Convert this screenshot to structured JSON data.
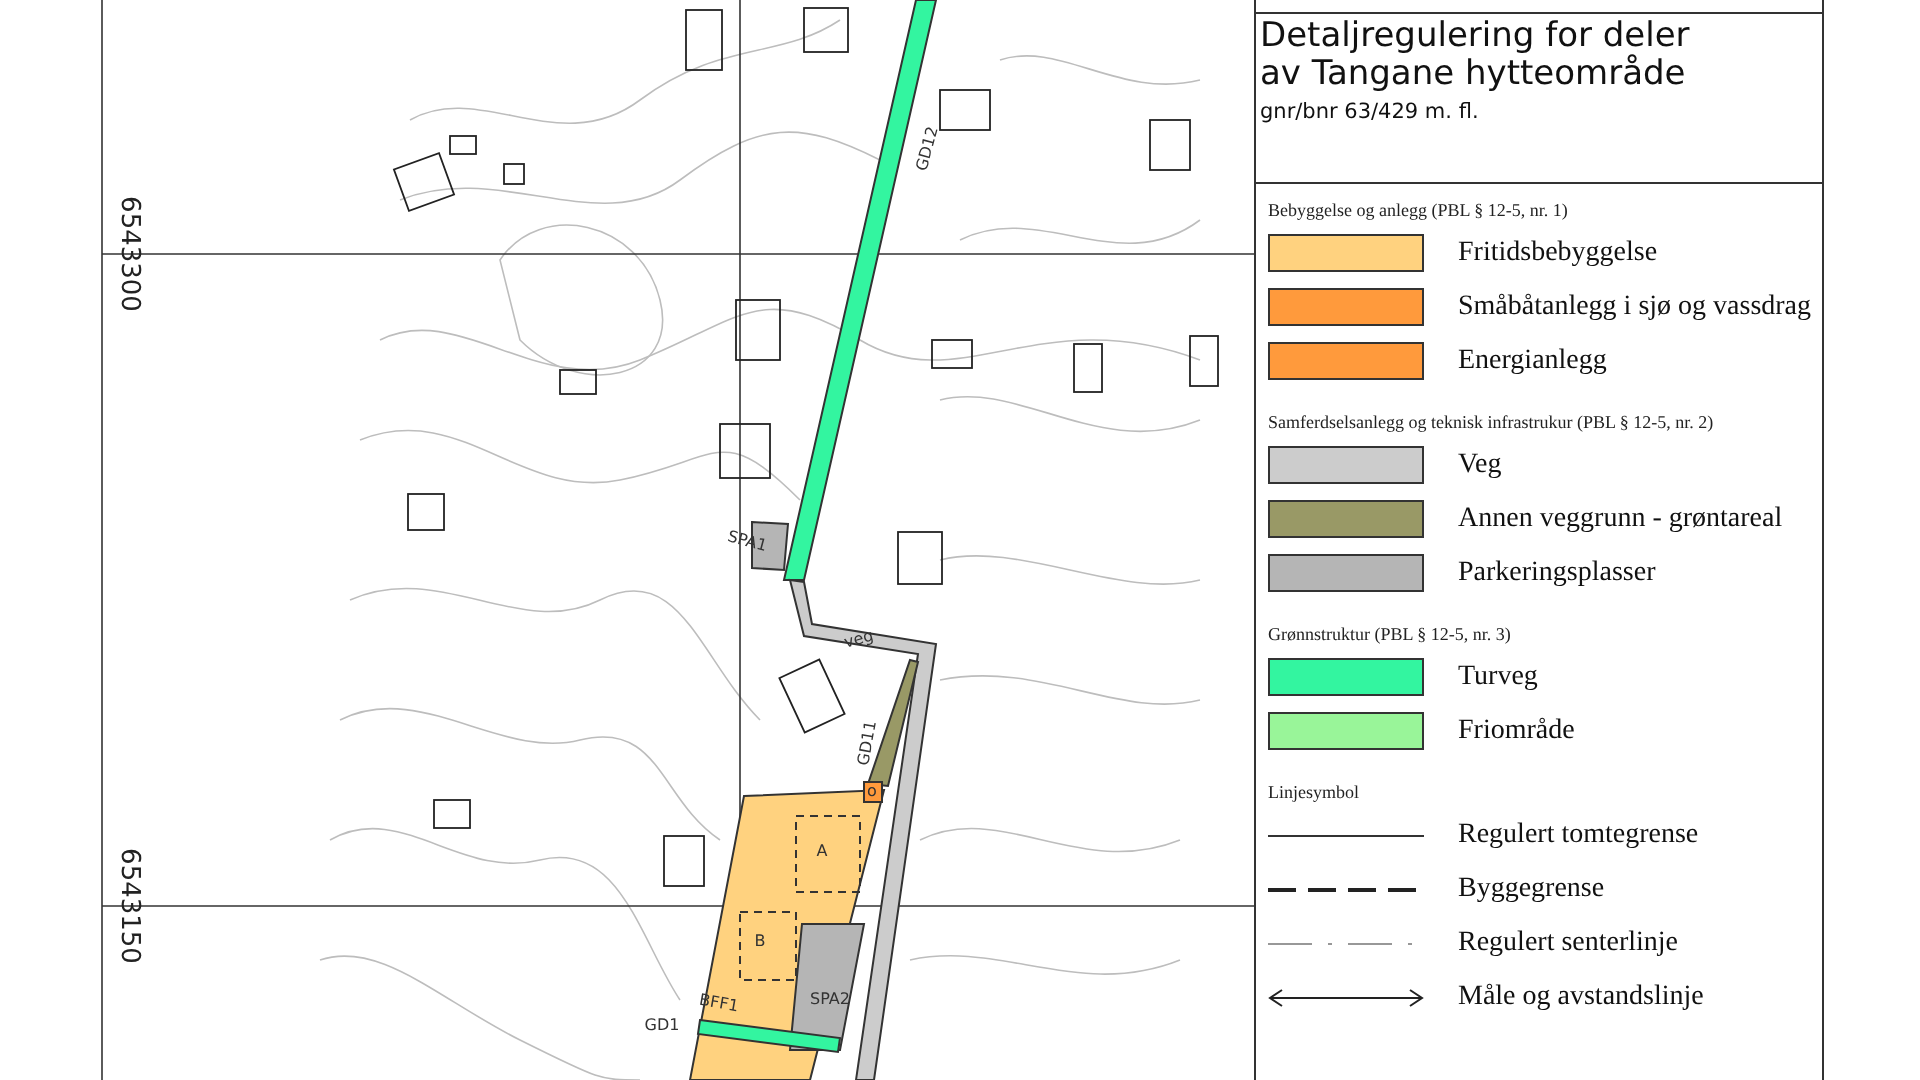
{
  "map": {
    "grid_labels": [
      "6543300",
      "6543150"
    ],
    "labels": [
      "GD12",
      "SPA1",
      "veg",
      "GD11",
      "o",
      "A",
      "B",
      "BFF1",
      "SPA2",
      "GD1"
    ]
  },
  "legend": {
    "title": [
      "Detaljregulering for deler",
      "av Tangane hytteområde"
    ],
    "subtitle": "gnr/bnr 63/429 m. fl.",
    "sections": [
      {
        "heading": "Bebyggelse og anlegg (PBL § 12-5, nr. 1)",
        "items": [
          {
            "kind": "fill",
            "label": "Fritidsbebyggelse",
            "color": "#ffd27f"
          },
          {
            "kind": "fill",
            "label": "Småbåtanlegg i sjø og vassdrag",
            "color": "#ff9a3c"
          },
          {
            "kind": "fill",
            "label": "Energianlegg",
            "color": "#ff9a3c"
          }
        ]
      },
      {
        "heading": "Samferdselsanlegg og teknisk infrastrukur (PBL § 12-5, nr. 2)",
        "items": [
          {
            "kind": "fill",
            "label": "Veg",
            "color": "#cccccc"
          },
          {
            "kind": "fill",
            "label": "Annen veggrunn - grøntareal",
            "color": "#999966"
          },
          {
            "kind": "fill",
            "label": "Parkeringsplasser",
            "color": "#b5b5b5"
          }
        ]
      },
      {
        "heading": "Grønnstruktur (PBL § 12-5, nr. 3)",
        "items": [
          {
            "kind": "fill",
            "label": "Turveg",
            "color": "#33f5a0"
          },
          {
            "kind": "fill",
            "label": "Friområde",
            "color": "#99f599"
          }
        ]
      },
      {
        "heading": "Linjesymbol",
        "items": [
          {
            "kind": "solid",
            "label": "Regulert tomtegrense"
          },
          {
            "kind": "dashed",
            "label": "Byggegrense"
          },
          {
            "kind": "dashdot",
            "label": "Regulert senterlinje"
          },
          {
            "kind": "dimension",
            "label": "Måle og avstandslinje"
          }
        ]
      }
    ]
  }
}
